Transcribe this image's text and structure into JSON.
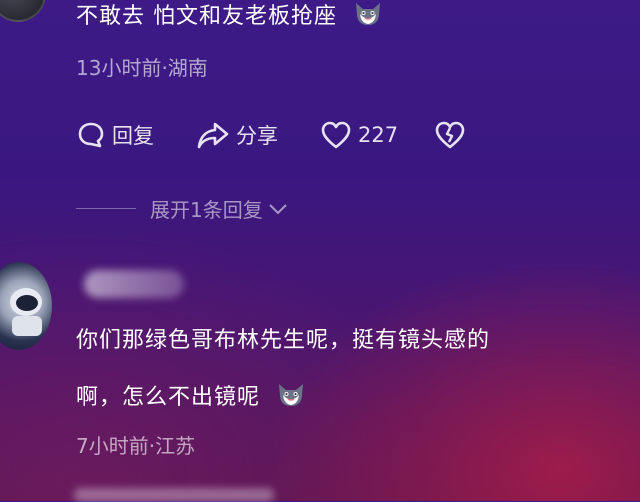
{
  "comment1": {
    "text": "不敢去 怕文和友老板抢座",
    "emoji_icon": "cat-face-icon",
    "meta": "13小时前·湖南",
    "actions": {
      "reply_label": "回复",
      "share_label": "分享",
      "like_count": "227",
      "dislike_icon": "broken-heart-icon"
    },
    "expand_label": "展开1条回复"
  },
  "comment2": {
    "text_line1": "你们那绿色哥布林先生呢，挺有镜头感的",
    "text_line2": "啊，怎么不出镜呢",
    "emoji_icon": "cat-face-icon",
    "meta": "7小时前·江苏"
  },
  "colors": {
    "background_top": "#3d1a86",
    "background_bottom": "#5a1652",
    "text": "#ffffff",
    "meta_text": "#b9aed1"
  }
}
